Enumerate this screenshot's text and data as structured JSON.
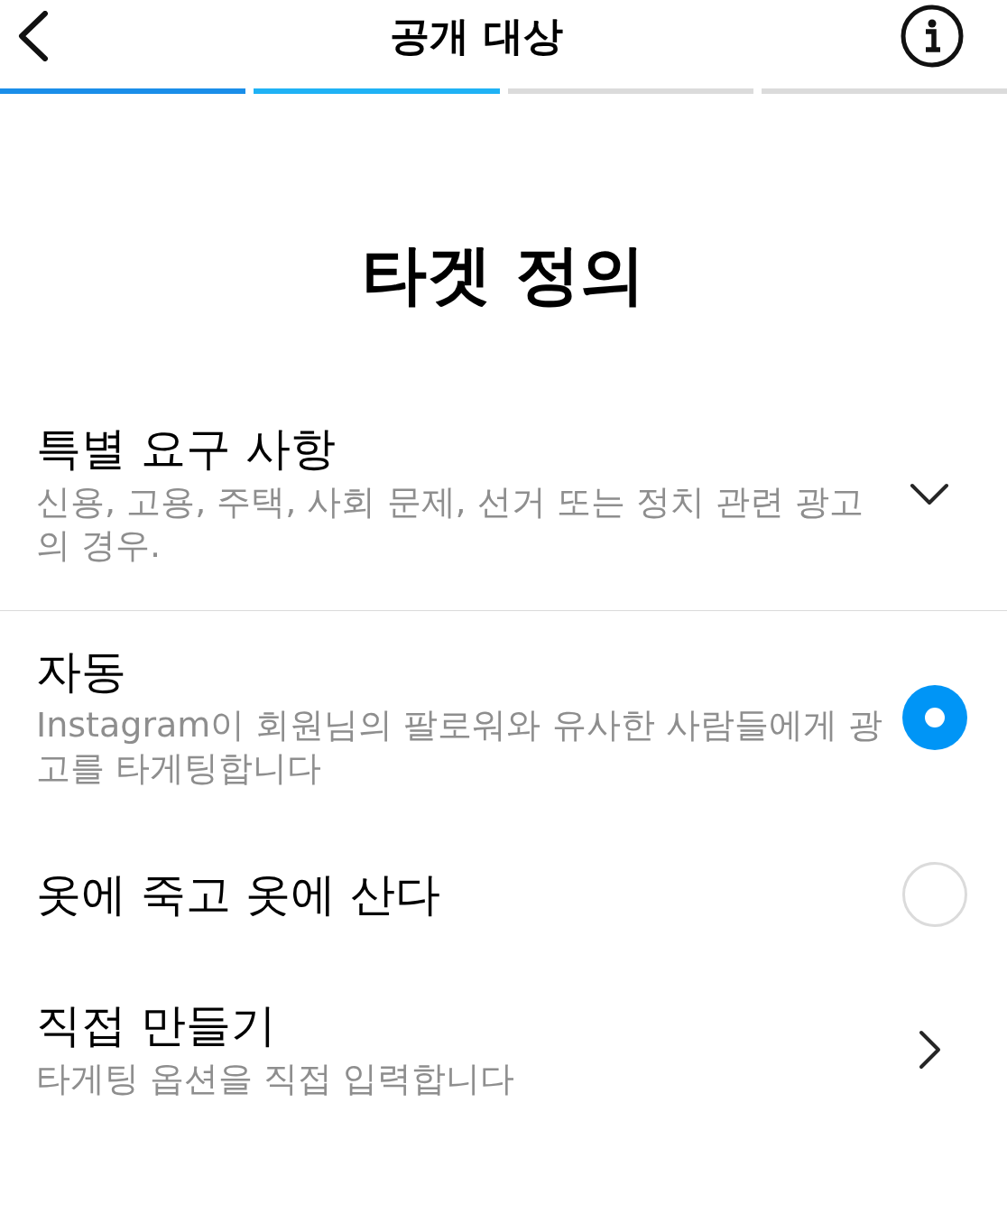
{
  "header": {
    "title": "공개 대상"
  },
  "progress": [
    {
      "filled": true
    },
    {
      "filled": true
    },
    {
      "filled": false
    },
    {
      "filled": false
    }
  ],
  "heading": "타겟 정의",
  "options": [
    {
      "kind": "accordion",
      "title": "특별 요구 사항",
      "description": "신용, 고용, 주택, 사회 문제, 선거 또는 정치 관련 광고의 경우.",
      "expanded": false
    },
    {
      "kind": "radio",
      "title": "자동",
      "description": "Instagram이 회원님의 팔로워와 유사한 사람들에게 광고를 타게팅합니다",
      "selected": true
    },
    {
      "kind": "radio",
      "title": "옷에 죽고 옷에 산다",
      "selected": false
    },
    {
      "kind": "link",
      "title": "직접 만들기",
      "description": "타게팅 옵션을 직접 입력합니다"
    }
  ]
}
